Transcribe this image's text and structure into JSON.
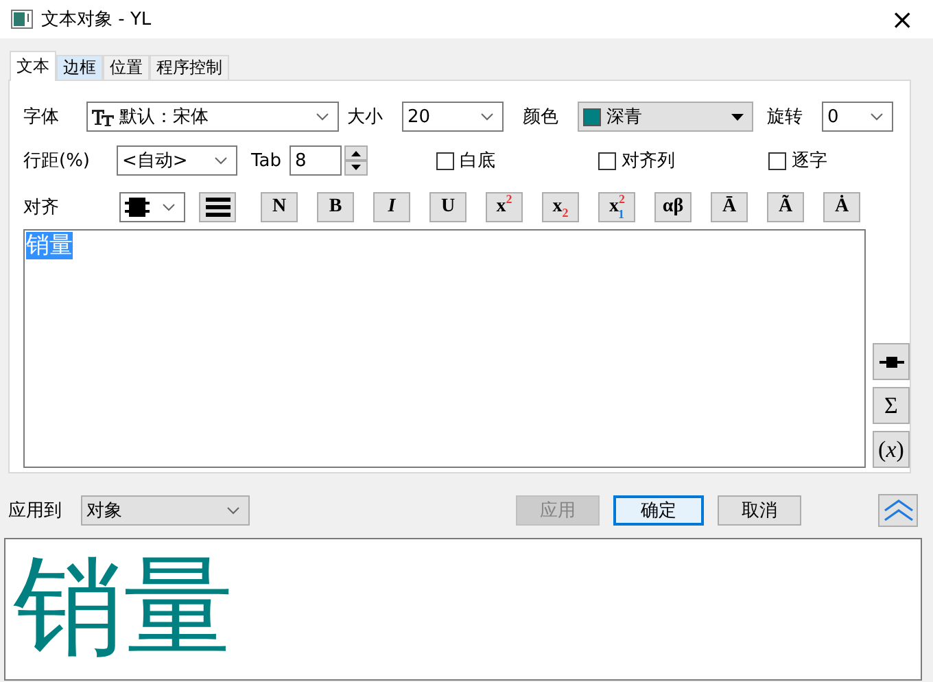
{
  "window": {
    "title": "文本对象 - YL",
    "close": "×"
  },
  "tabs": [
    {
      "label": "文本",
      "selected": true
    },
    {
      "label": "边框",
      "selected": false
    },
    {
      "label": "位置",
      "selected": false
    },
    {
      "label": "程序控制",
      "selected": false
    }
  ],
  "font": {
    "label": "字体",
    "value": "默认：宋体"
  },
  "size": {
    "label": "大小",
    "value": "20"
  },
  "color": {
    "label": "颜色",
    "value": "深青",
    "color": "#008080"
  },
  "rotation": {
    "label": "旋转",
    "value": "0"
  },
  "line_spacing": {
    "label": "行距(%)",
    "value": "<自动>"
  },
  "tab_stop": {
    "label": "Tab",
    "value": "8"
  },
  "checkboxes": [
    {
      "label": "白底",
      "checked": false
    },
    {
      "label": "对齐列",
      "checked": false
    },
    {
      "label": "逐字",
      "checked": false
    }
  ],
  "align": {
    "label": "对齐"
  },
  "format_buttons": [
    {
      "label": "N"
    },
    {
      "label": "B"
    },
    {
      "label": "*I*"
    },
    {
      "label": "U"
    },
    {
      "label": "x$^{2}$"
    },
    {
      "label": "x$_{2}$"
    },
    {
      "label": "x$^{2}$$_{1}$"
    },
    {
      "label": "αβ"
    },
    {
      "label": "Ā"
    },
    {
      "label": "Ã"
    },
    {
      "label": "Ȧ"
    }
  ],
  "editor": {
    "text": "销量",
    "selected": true
  },
  "side_buttons": [
    {
      "kind": "icon"
    },
    {
      "kind": "text",
      "label": "Σ"
    },
    {
      "kind": "text",
      "label": "(*x*)"
    }
  ],
  "apply_to": {
    "label": "应用到",
    "value": "对象"
  },
  "buttons": [
    {
      "label": "应用",
      "disabled": true,
      "default": false
    },
    {
      "label": "确定",
      "disabled": false,
      "default": true
    },
    {
      "label": "取消",
      "disabled": false,
      "default": false
    }
  ],
  "preview": {
    "text": "销量"
  }
}
